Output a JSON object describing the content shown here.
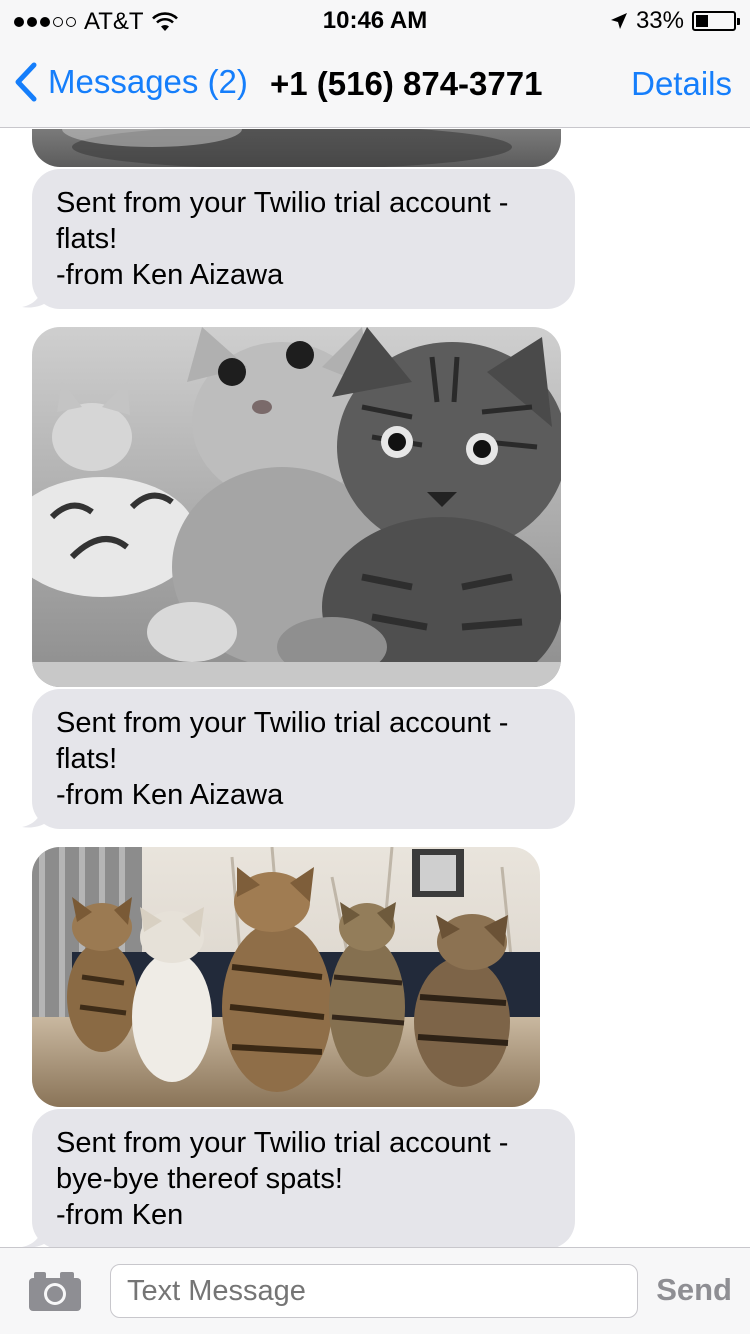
{
  "status_bar": {
    "carrier": "AT&T",
    "signal_bars_filled": 3,
    "signal_bars_total": 5,
    "time": "10:46 AM",
    "battery_percent_label": "33%",
    "battery_level": 0.33
  },
  "nav": {
    "back_label": "Messages (2)",
    "title": "+1 (516) 874-3771",
    "details_label": "Details"
  },
  "messages": [
    {
      "type": "image",
      "content": "black-and-white kitten photo (cropped at top)"
    },
    {
      "type": "text",
      "lines": [
        "Sent from your Twilio trial account -",
        "flats!",
        "-from Ken Aizawa"
      ]
    },
    {
      "type": "image",
      "content": "black-and-white photo of two kittens"
    },
    {
      "type": "text",
      "lines": [
        "Sent from your Twilio trial account -",
        "flats!",
        "-from Ken Aizawa"
      ]
    },
    {
      "type": "image",
      "content": "five kittens looking up"
    },
    {
      "type": "text",
      "lines": [
        "Sent from your Twilio trial account -",
        "bye-bye thereof spats!",
        "-from Ken"
      ]
    }
  ],
  "input": {
    "placeholder": "Text Message",
    "send_label": "Send"
  },
  "colors": {
    "accent": "#157efb",
    "bubble": "#e5e5ea",
    "bar_bg": "#f7f7f8"
  },
  "icons": [
    "chevron-left-icon",
    "camera-icon",
    "location-arrow-icon",
    "wifi-icon",
    "battery-icon"
  ]
}
